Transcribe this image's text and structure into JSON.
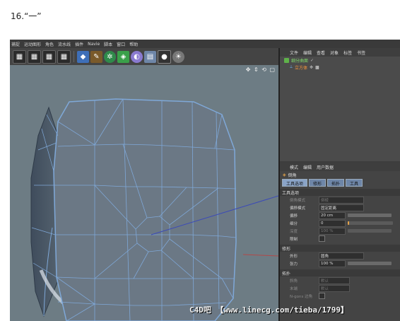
{
  "caption": "16.“一”",
  "menubar": [
    "捕捉",
    "运动图形",
    "角色",
    "流水线",
    "插件",
    "Navie",
    "脚本",
    "窗口",
    "帮助"
  ],
  "toolbar_icons": [
    "clapboard-icon",
    "clapboard-icon",
    "clapboard-icon",
    "clapboard-icon",
    "cube-icon",
    "pen-icon",
    "gear-icon",
    "subdivide-icon",
    "deformer-icon",
    "floor-grid-icon",
    "camera-icon",
    "light-bulb-icon"
  ],
  "viewport": {
    "nav_icons": "✥ ⇕ ⟲ ▢"
  },
  "object_manager": {
    "menu": [
      "文件",
      "编辑",
      "查看",
      "对象",
      "标签",
      "书签"
    ],
    "objects": [
      {
        "name": "细分曲面",
        "color": "#5fb24a"
      },
      {
        "name": "立方体",
        "color": "#e0a14a"
      }
    ]
  },
  "attribute_manager": {
    "menu": [
      "模式",
      "编辑",
      "用户数据"
    ],
    "title": "倒角",
    "tabs": [
      "工具选项",
      "修形",
      "拓扑",
      "工具"
    ],
    "sections": {
      "tool_options": "工具选项",
      "shaping": "修形",
      "topology": "拓扑"
    },
    "rows": {
      "bevel_mode_label": "倒角模式",
      "bevel_mode_value": "倒棱",
      "offset_mode_label": "偏移模式",
      "offset_mode_value": "固定距离",
      "offset_label": "偏移",
      "offset_value": "20 cm",
      "subdivision_label": "细分",
      "subdivision_value": "0",
      "depth_label": "深度",
      "depth_value": "100 %",
      "limit_label": "限制",
      "shape_label": "外形",
      "shape_value": "圆角",
      "tension_label": "张力",
      "tension_value": "100 %",
      "corner_label": "斜角",
      "corner_value": "默认",
      "end_label": "末端",
      "end_value": "默认",
      "ngon_label": "N-gons 边角"
    }
  },
  "watermark": "C4D吧 【www.linecg.com/tieba/1799】"
}
